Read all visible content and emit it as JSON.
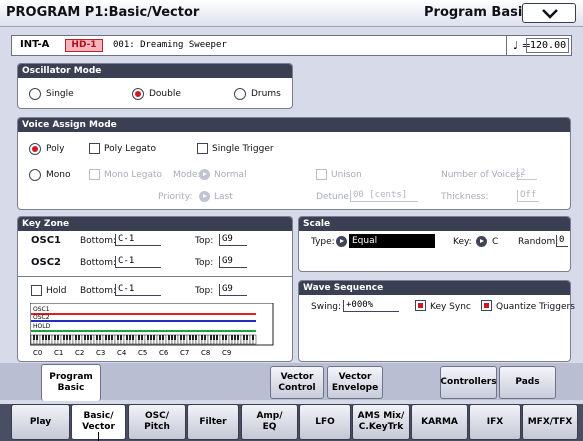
{
  "header": {
    "title": "PROGRAM P1:Basic/Vector",
    "page": "Program Basic"
  },
  "program": {
    "bank": "INT-A",
    "hd": "HD-1",
    "name": "001: Dreaming Sweeper",
    "note_symbol": "♩ =",
    "tempo": "120.00"
  },
  "osc_mode": {
    "header": "Oscillator Mode",
    "single": "Single",
    "double": "Double",
    "drums": "Drums",
    "selected": "Double"
  },
  "voice": {
    "header": "Voice Assign Mode",
    "poly": "Poly",
    "poly_legato": "Poly Legato",
    "single_trigger": "Single Trigger",
    "mono": "Mono",
    "mono_legato": "Mono Legato",
    "mode_label": "Mode:",
    "mode_value": "Normal",
    "priority_label": "Priority:",
    "priority_value": "Last",
    "unison": "Unison",
    "detune_label": "Detune:",
    "detune_value": "00 [cents]",
    "num_voices_label": "Number of Voices:",
    "num_voices_value": "2",
    "thickness_label": "Thickness:",
    "thickness_value": "Off"
  },
  "keyzone": {
    "header": "Key Zone",
    "osc1": "OSC1",
    "osc2": "OSC2",
    "bottom_label": "Bottom:",
    "top_label": "Top:",
    "osc1_bottom": "C-1",
    "osc1_top": "G9",
    "osc2_bottom": "C-1",
    "osc2_top": "G9",
    "hold": "Hold",
    "hold_bottom": "C-1",
    "hold_top": "G9",
    "legend": [
      "OSC1",
      "OSC2",
      "HOLD"
    ],
    "octaves": [
      "C0",
      "C1",
      "C2",
      "C3",
      "C4",
      "C5",
      "C6",
      "C7",
      "C8",
      "C9"
    ]
  },
  "scale": {
    "header": "Scale",
    "type_label": "Type:",
    "type_value": "Equal Temperament",
    "key_label": "Key:",
    "key_value": "C",
    "random_label": "Random:",
    "random_value": "0"
  },
  "wave": {
    "header": "Wave Sequence",
    "swing_label": "Swing:",
    "swing_value": "+000%",
    "key_sync": "Key Sync",
    "quantize": "Quantize Triggers"
  },
  "subtabs": [
    "Program Basic",
    "Vector Control",
    "Vector Envelope",
    "Controllers",
    "Pads"
  ],
  "pagetabs": [
    "Play",
    "Basic/ Vector",
    "OSC/ Pitch",
    "Filter",
    "Amp/ EQ",
    "LFO",
    "AMS Mix/ C.KeyTrk",
    "KARMA",
    "IFX",
    "MFX/TFX"
  ],
  "colors": {
    "osc1": "#e02020",
    "osc2": "#2030c0",
    "hold": "#20a040",
    "accent": "#d01822"
  }
}
